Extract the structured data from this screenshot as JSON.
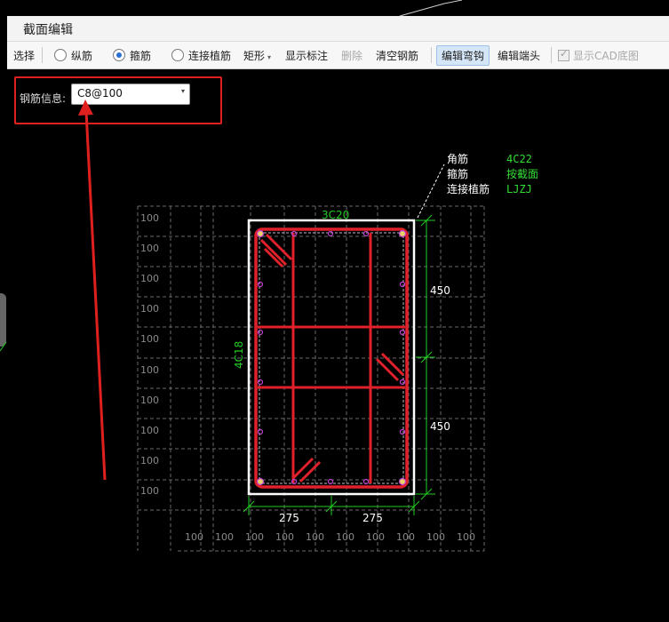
{
  "window": {
    "title": "截面编辑"
  },
  "toolbar": {
    "select": "选择",
    "longitudinal": "纵筋",
    "stirrup": "箍筋",
    "dowel": "连接植筋",
    "shape": "矩形",
    "show_annotation": "显示标注",
    "delete": "删除",
    "clear_rebar": "清空钢筋",
    "edit_bend_hook": "编辑弯钩",
    "edit_end": "编辑端头",
    "show_cad": "显示CAD底图"
  },
  "rebar_info": {
    "label": "钢筋信息:",
    "value": "C8@100"
  },
  "drawing": {
    "legend": [
      {
        "key": "角筋",
        "value": "4C22"
      },
      {
        "key": "箍筋",
        "value": "按截面"
      },
      {
        "key": "连接植筋",
        "value": "LJZJ"
      }
    ],
    "top_rebar": "3C20",
    "side_rebar": "4C18",
    "dim_right": [
      "450",
      "450"
    ],
    "dim_bottom": [
      "275",
      "275"
    ],
    "grid_label": "100",
    "colors": {
      "rebar": "#e0202a",
      "dimension": "#22cc22",
      "grid": "#6a6a6a",
      "highlight": "#e0201f"
    }
  }
}
